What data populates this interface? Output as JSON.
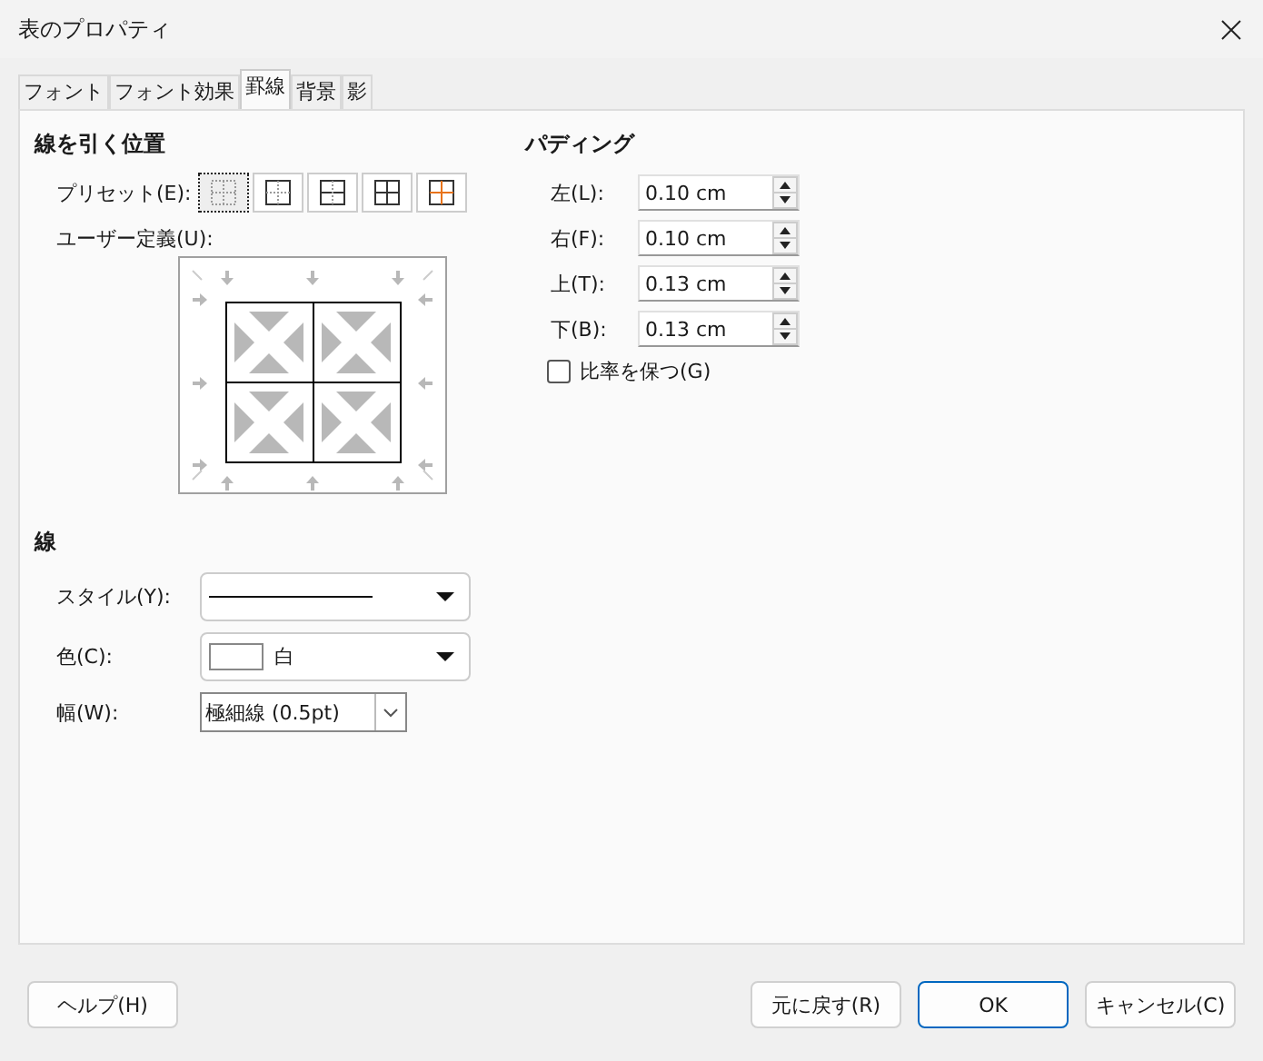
{
  "window": {
    "title": "表のプロパティ"
  },
  "tabs": [
    {
      "label": "フォント",
      "selected": false
    },
    {
      "label": "フォント効果",
      "selected": false
    },
    {
      "label": "罫線",
      "selected": true
    },
    {
      "label": "背景",
      "selected": false
    },
    {
      "label": "影",
      "selected": false
    }
  ],
  "line_arrangement": {
    "heading": "線を引く位置",
    "preset_label": "プリセット(E):",
    "presets": [
      {
        "kind": "none",
        "selected": true
      },
      {
        "kind": "outer",
        "selected": false
      },
      {
        "kind": "outer-horizontal",
        "selected": false
      },
      {
        "kind": "all",
        "selected": false
      },
      {
        "kind": "outer-inner-highlight",
        "selected": false
      }
    ],
    "user_defined_label": "ユーザー定義(U):"
  },
  "line": {
    "heading": "線",
    "style_label": "スタイル(Y):",
    "color_label": "色(C):",
    "color_value": "白",
    "width_label": "幅(W):",
    "width_value": "極細線 (0.5pt)"
  },
  "padding": {
    "heading": "パディング",
    "fields": [
      {
        "label": "左(L):",
        "value": "0.10 cm"
      },
      {
        "label": "右(F):",
        "value": "0.10 cm"
      },
      {
        "label": "上(T):",
        "value": "0.13 cm"
      },
      {
        "label": "下(B):",
        "value": "0.13 cm"
      }
    ],
    "keep_ratio": {
      "label": "比率を保つ(G)",
      "checked": false
    }
  },
  "buttons": [
    {
      "label": "ヘルプ(H)",
      "default": false
    },
    {
      "label": "元に戻す(R)",
      "default": false
    },
    {
      "label": "OK",
      "default": true
    },
    {
      "label": "キャンセル(C)",
      "default": false
    }
  ]
}
